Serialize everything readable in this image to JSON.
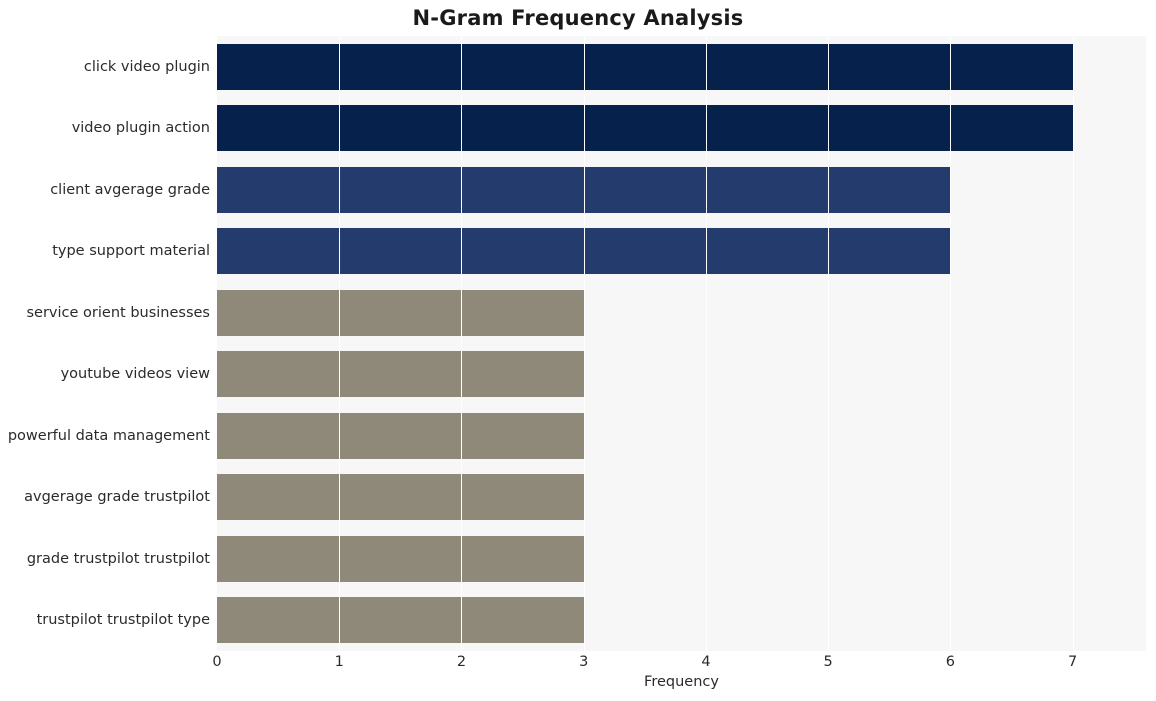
{
  "chart_data": {
    "type": "bar",
    "orientation": "horizontal",
    "title": "N-Gram Frequency Analysis",
    "xlabel": "Frequency",
    "ylabel": "",
    "categories": [
      "click video plugin",
      "video plugin action",
      "client avgerage grade",
      "type support material",
      "service orient businesses",
      "youtube videos view",
      "powerful data management",
      "avgerage grade trustpilot",
      "grade trustpilot trustpilot",
      "trustpilot trustpilot type"
    ],
    "values": [
      7,
      7,
      6,
      6,
      3,
      3,
      3,
      3,
      3,
      3
    ],
    "bar_colors": [
      "#06214b",
      "#06214b",
      "#233c6d",
      "#233c6d",
      "#8f897a",
      "#8f897a",
      "#8f897a",
      "#8f897a",
      "#8f897a",
      "#8f897a"
    ],
    "xlim": [
      0,
      7.6
    ],
    "xticks": [
      0,
      1,
      2,
      3,
      4,
      5,
      6,
      7
    ],
    "xticklabels": [
      "0",
      "1",
      "2",
      "3",
      "4",
      "5",
      "6",
      "7"
    ],
    "grid": true,
    "grid_axis": "x",
    "legend": null,
    "plot_background": "#f7f7f7",
    "figure_background": "#ffffff"
  }
}
